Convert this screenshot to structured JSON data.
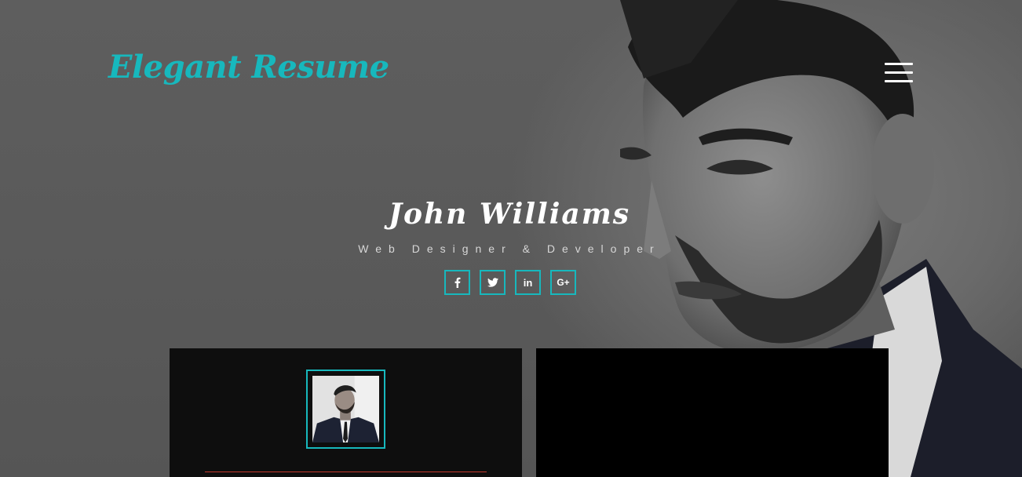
{
  "header": {
    "logo": "Elegant Resume",
    "menu_icon": "hamburger-menu-icon"
  },
  "profile": {
    "name": "John Williams",
    "role": "Web Designer & Developer"
  },
  "socials": [
    {
      "icon": "facebook-icon",
      "glyph": "f"
    },
    {
      "icon": "twitter-icon",
      "glyph": "🐦"
    },
    {
      "icon": "linkedin-icon",
      "glyph": "in"
    },
    {
      "icon": "google-plus-icon",
      "glyph": "G+"
    }
  ],
  "colors": {
    "accent": "#17b8bd",
    "divider": "#c0392b",
    "card_left_bg": "#0e0e0e",
    "card_right_bg": "#000000"
  }
}
